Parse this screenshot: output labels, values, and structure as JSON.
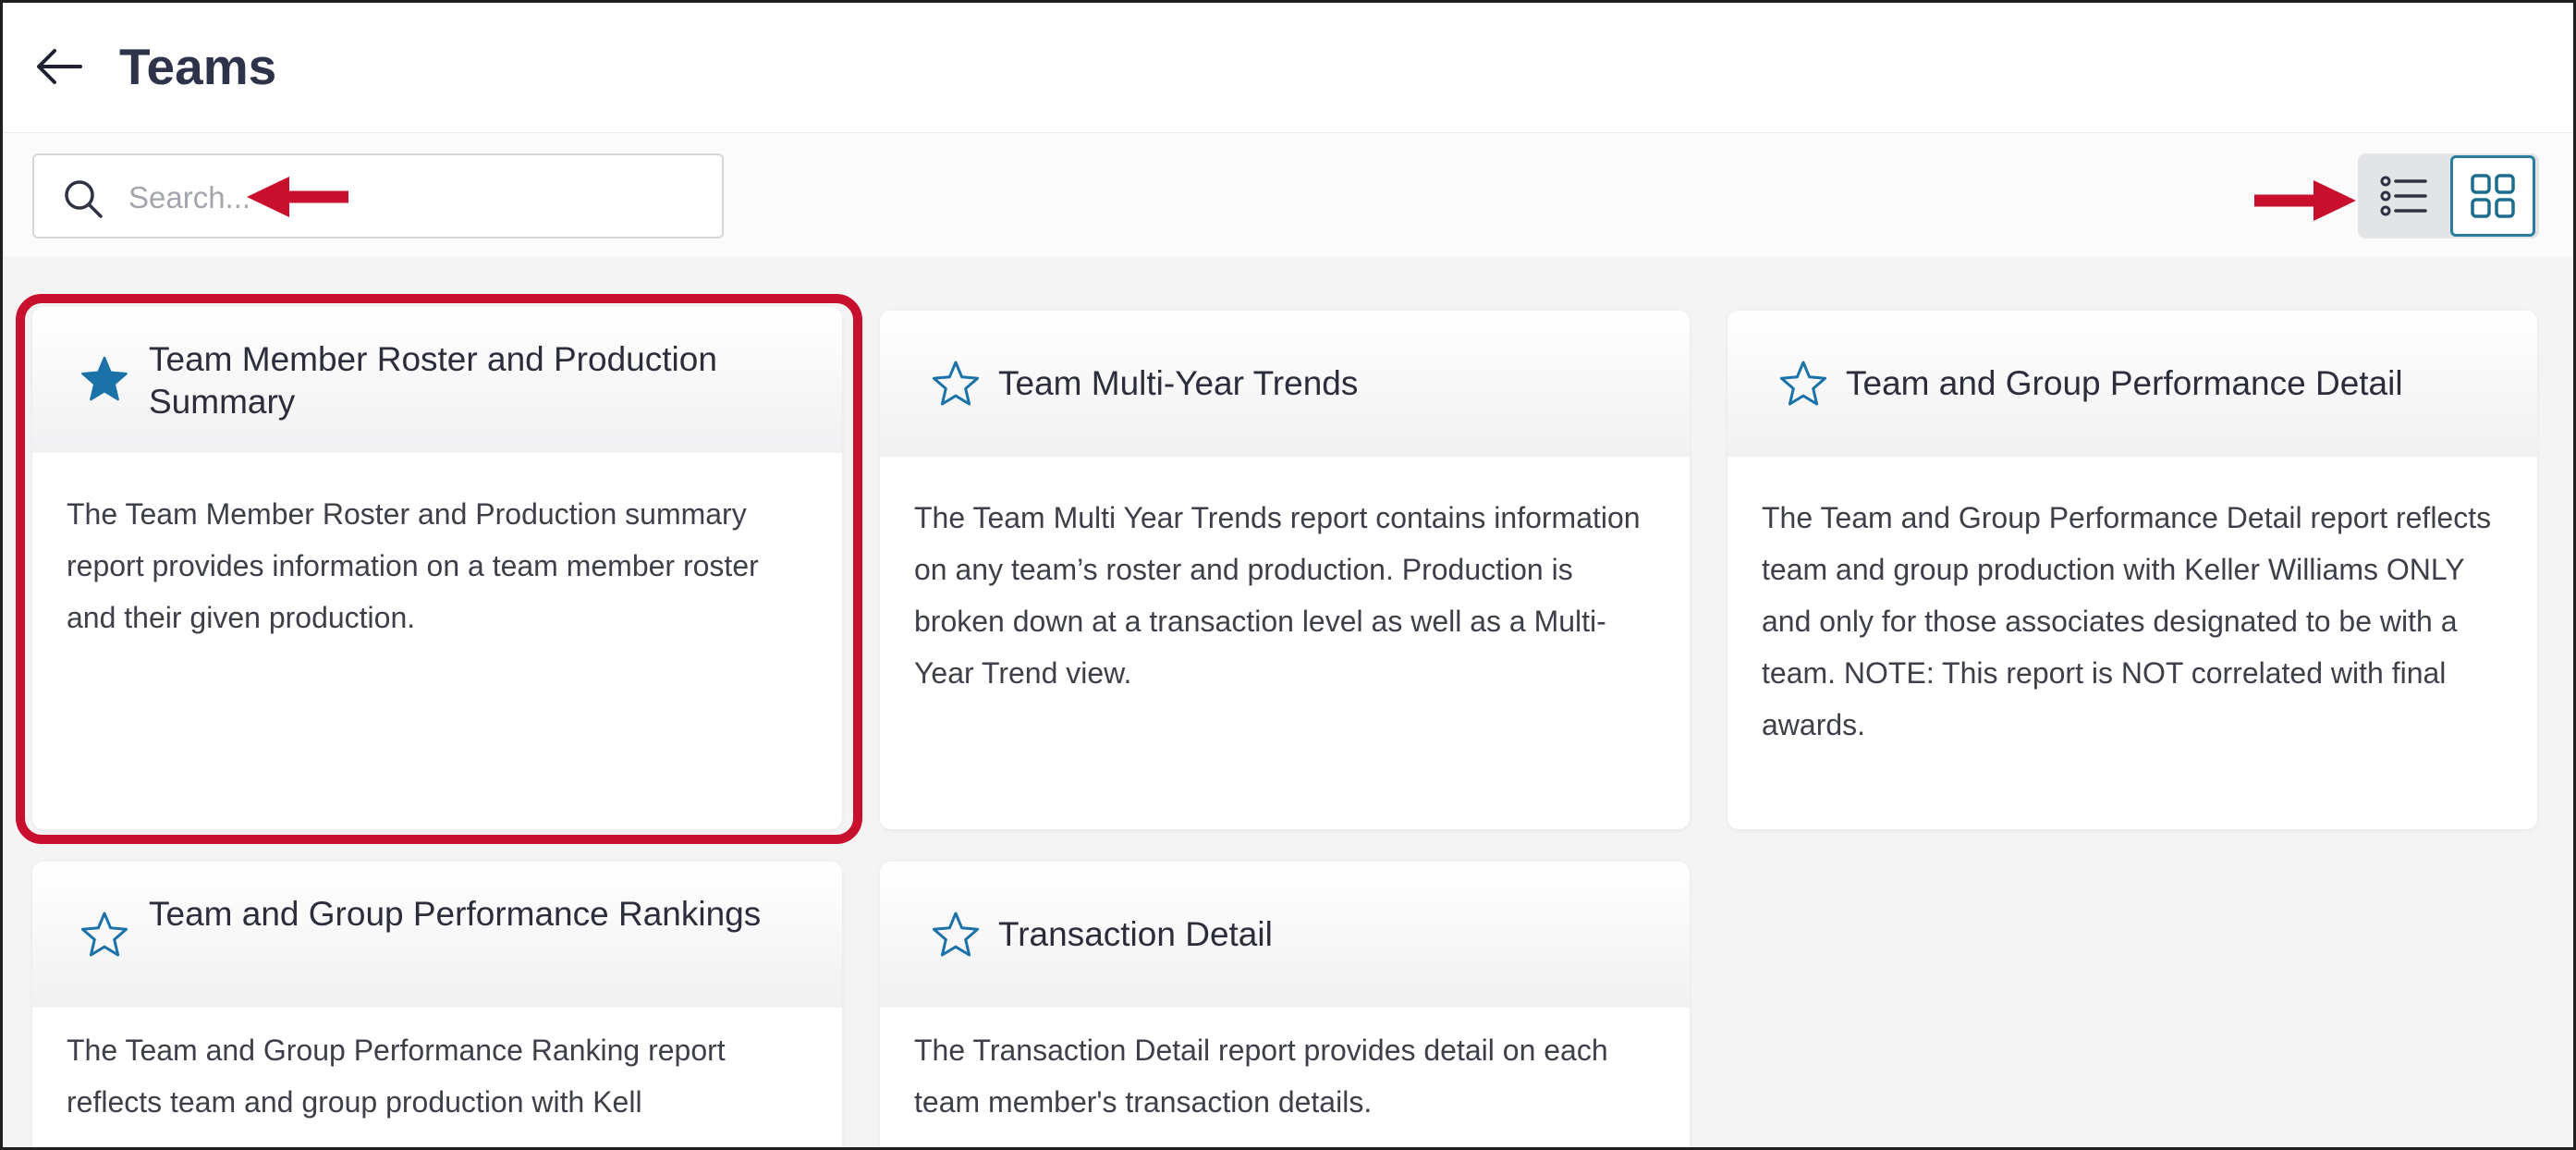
{
  "header": {
    "title": "Teams",
    "back_icon": "arrow-left-icon"
  },
  "search": {
    "placeholder": "Search...",
    "value": "",
    "icon": "search-icon"
  },
  "view_toggle": {
    "options": [
      {
        "name": "list",
        "icon": "list-icon",
        "selected": false
      },
      {
        "name": "grid",
        "icon": "grid-icon",
        "selected": true
      }
    ]
  },
  "annotation_color": "#c8102e",
  "accent_color": "#2a7ca0",
  "cards": [
    {
      "title": "Team Member Roster and Production Summary",
      "description": "The Team Member Roster and Production summary report provides information on a team member roster and their given production.",
      "favorite": true
    },
    {
      "title": "Team Multi-Year Trends",
      "description": "The Team Multi Year Trends report contains information on any team’s roster and production. Production is broken down at a transaction level as well as a Multi-Year Trend view.",
      "favorite": false
    },
    {
      "title": "Team and Group Performance Detail",
      "description": "The Team and Group Performance Detail report reflects team and group production with Keller Williams ONLY and only for those associates designated to be with a team. NOTE: This report is NOT correlated with final awards.",
      "favorite": false
    },
    {
      "title": "Team and Group Performance Rankings",
      "description": "The Team and Group Performance Ranking report reflects team and group production with Kell",
      "favorite": false
    },
    {
      "title": "Transaction Detail",
      "description": "The Transaction Detail report provides detail on each team member's transaction details.",
      "favorite": false
    }
  ]
}
